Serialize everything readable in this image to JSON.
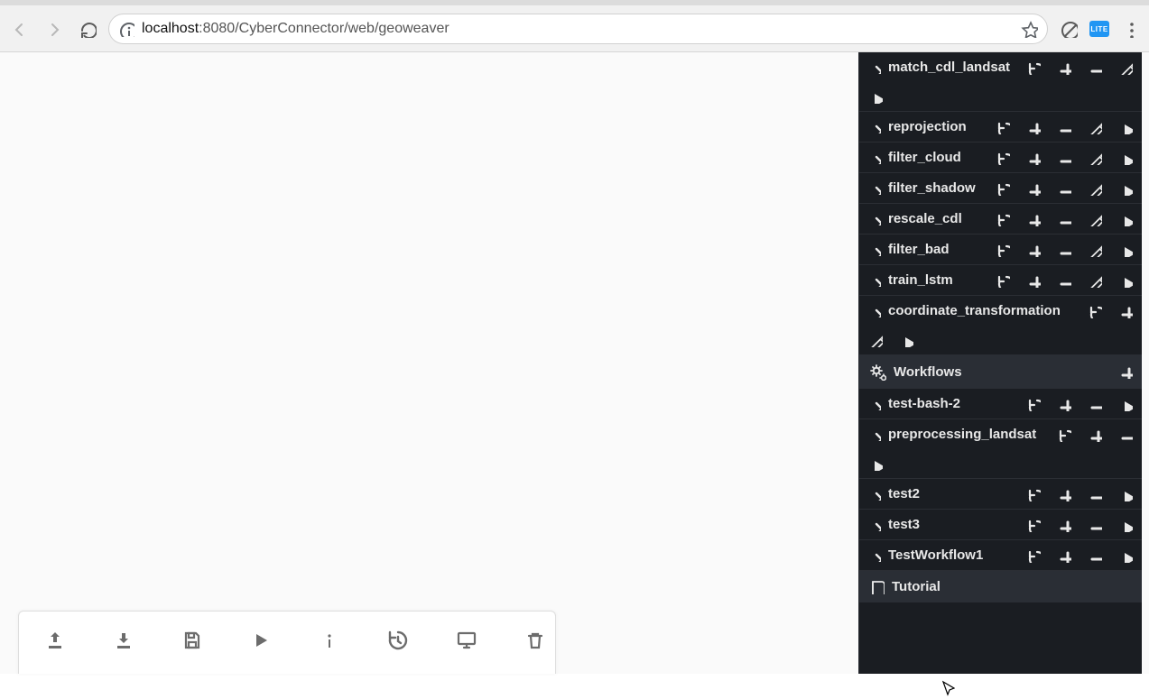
{
  "browser": {
    "url_host_muted": "localhost",
    "url_port": ":8080",
    "url_path": "/CyberConnector/web/geoweaver",
    "lite_badge": "LITE"
  },
  "sidebar": {
    "processes": [
      {
        "name": "match_cdl_landsat",
        "hist": true,
        "add": true,
        "sub": true,
        "edit": true,
        "play": true,
        "overflow": "edit_play"
      },
      {
        "name": "reprojection",
        "hist": true,
        "add": true,
        "sub": true,
        "edit": true,
        "play": true
      },
      {
        "name": "filter_cloud",
        "hist": true,
        "add": true,
        "sub": true,
        "edit": true,
        "play": true
      },
      {
        "name": "filter_shadow",
        "hist": true,
        "add": true,
        "sub": true,
        "edit": true,
        "play": true
      },
      {
        "name": "rescale_cdl",
        "hist": true,
        "add": true,
        "sub": true,
        "edit": true,
        "play": true
      },
      {
        "name": "filter_bad",
        "hist": true,
        "add": true,
        "sub": true,
        "edit": true,
        "play": true
      },
      {
        "name": "train_lstm",
        "hist": true,
        "add": true,
        "sub": true,
        "edit": true,
        "play": true
      },
      {
        "name": "coordinate_transformation",
        "hist": true,
        "add": true,
        "sub": false,
        "edit": true,
        "play": true,
        "overflow": "sub_edit_play"
      }
    ],
    "workflows_header": "Workflows",
    "workflows": [
      {
        "name": "test-bash-2",
        "hist": true,
        "add": true,
        "sub": true,
        "play": true
      },
      {
        "name": "preprocessing_landsat",
        "hist": true,
        "add": true,
        "sub": true,
        "play": true,
        "overflow": "play"
      },
      {
        "name": "test2",
        "hist": true,
        "add": true,
        "sub": true,
        "play": true
      },
      {
        "name": "test3",
        "hist": true,
        "add": true,
        "sub": true,
        "play": true
      },
      {
        "name": "TestWorkflow1",
        "hist": true,
        "add": true,
        "sub": true,
        "play": true
      }
    ],
    "tutorial_label": "Tutorial"
  }
}
